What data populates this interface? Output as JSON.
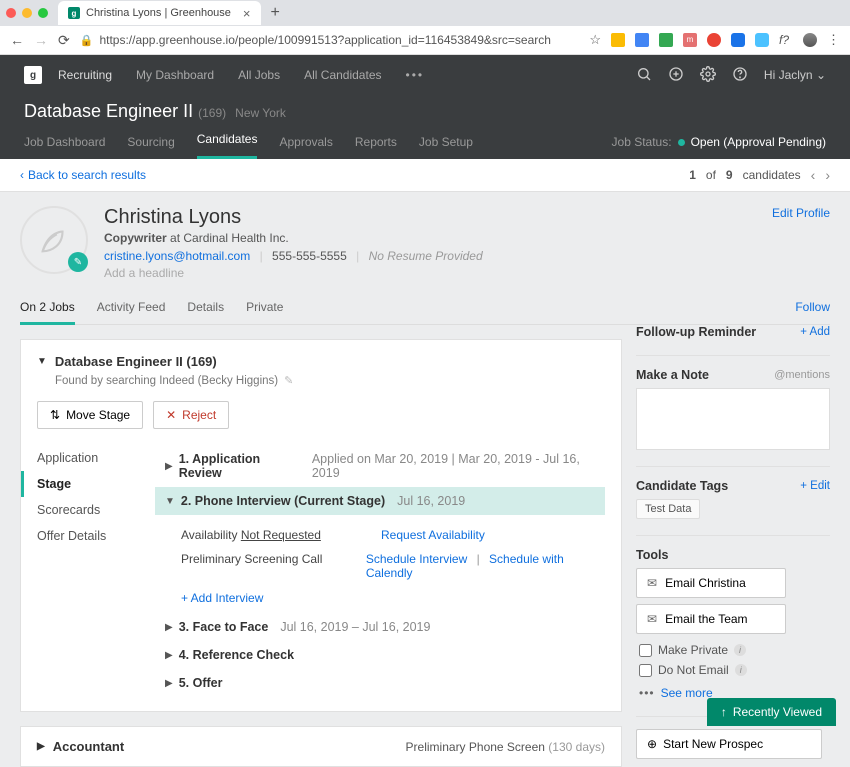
{
  "browser": {
    "tab_title": "Christina Lyons | Greenhouse",
    "url": "https://app.greenhouse.io/people/100991513?application_id=116453849&src=search"
  },
  "topnav": {
    "recruiting": "Recruiting",
    "dashboard": "My Dashboard",
    "all_jobs": "All Jobs",
    "all_candidates": "All Candidates",
    "user_menu": "Hi Jaclyn"
  },
  "job": {
    "title": "Database Engineer II",
    "count": "(169)",
    "location": "New York",
    "status_label": "Job Status:",
    "status_value": "Open (Approval Pending)"
  },
  "subnav": {
    "dashboard": "Job Dashboard",
    "sourcing": "Sourcing",
    "candidates": "Candidates",
    "approvals": "Approvals",
    "reports": "Reports",
    "setup": "Job Setup"
  },
  "breadcrumb": {
    "back": "Back to search results",
    "pager_current": "1",
    "pager_of": "of",
    "pager_total": "9",
    "pager_label": "candidates"
  },
  "candidate": {
    "name": "Christina Lyons",
    "title_line": "Copywriter",
    "at": " at Cardinal Health Inc.",
    "email": "cristine.lyons@hotmail.com",
    "phone": "555-555-5555",
    "no_resume": "No Resume Provided",
    "headline": "Add a headline",
    "edit_profile": "Edit Profile"
  },
  "profile_tabs": {
    "jobs": "On 2 Jobs",
    "feed": "Activity Feed",
    "details": "Details",
    "private": "Private",
    "follow": "Follow"
  },
  "job_card": {
    "title": "Database Engineer II (169)",
    "found_by": "Found by searching Indeed (Becky Higgins)",
    "move_stage": "Move Stage",
    "reject": "Reject"
  },
  "stage_nav": {
    "application": "Application",
    "stage": "Stage",
    "scorecards": "Scorecards",
    "offer": "Offer Details"
  },
  "stages": {
    "s1_label": "1. Application Review",
    "s1_dates": "Applied on Mar 20, 2019  |  Mar 20, 2019 - Jul 16, 2019",
    "s2_label": "2. Phone Interview (Current Stage)",
    "s2_date": "Jul 16, 2019",
    "avail_label": "Availability",
    "avail_status": "Not Requested",
    "request_avail": "Request Availability",
    "prelim_label": "Preliminary Screening Call",
    "schedule_interview": "Schedule Interview",
    "schedule_calendly": "Schedule with Calendly",
    "add_interview": "+ Add Interview",
    "s3_label": "3. Face to Face",
    "s3_dates": "Jul 16, 2019 – Jul 16, 2019",
    "s4_label": "4. Reference Check",
    "s5_label": "5. Offer"
  },
  "job_card2": {
    "title": "Accountant",
    "status": "Preliminary Phone Screen",
    "days": "(130 days)"
  },
  "rightcol": {
    "followup": "Follow-up Reminder",
    "add": "+ Add",
    "make_note": "Make a Note",
    "mentions": "@mentions",
    "tags_head": "Candidate Tags",
    "edit": "+ Edit",
    "tag_value": "Test Data",
    "tools_head": "Tools",
    "email_candidate": "Email Christina",
    "email_team": "Email the Team",
    "make_private": "Make Private",
    "do_not_email": "Do Not Email",
    "see_more": "See more",
    "start_prospect": "Start New Prospec"
  },
  "recently_viewed": "Recently Viewed"
}
